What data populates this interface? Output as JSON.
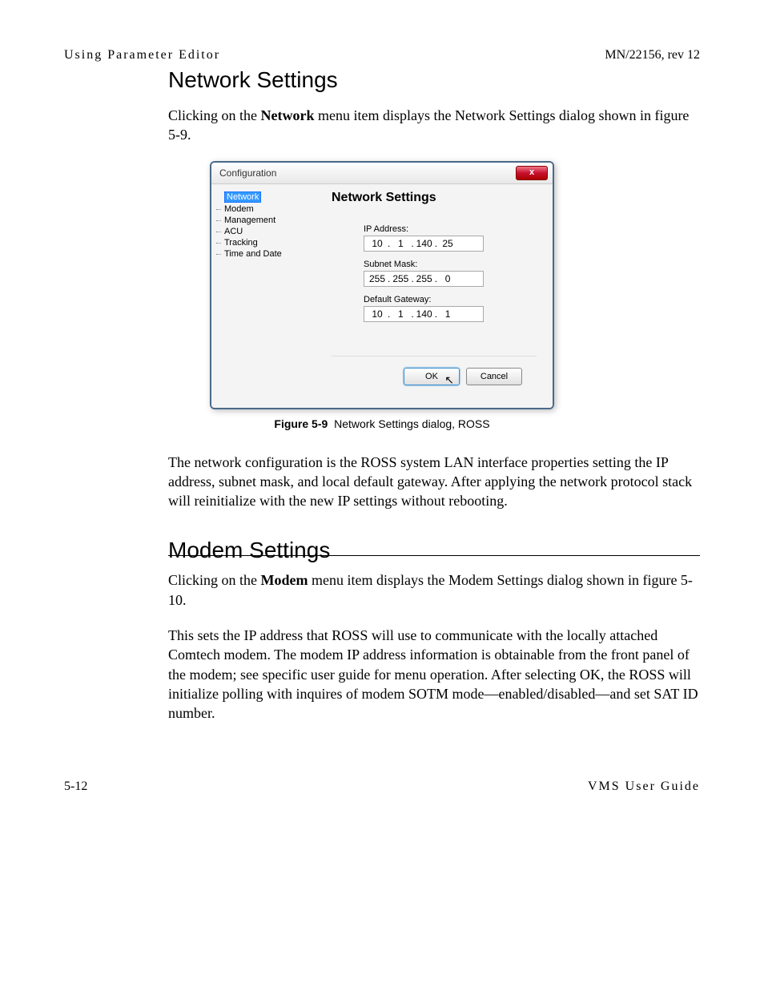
{
  "header": {
    "left": "Using Parameter Editor",
    "right": "MN/22156, rev 12"
  },
  "section1": {
    "title": "Network Settings",
    "para1_parts": [
      "Clicking on the ",
      "Network",
      " menu item displays the Network Settings dialog shown in figure 5-9."
    ]
  },
  "dialog": {
    "title": "Configuration",
    "close": "x",
    "tree": {
      "items": [
        "Network",
        "Modem",
        "Management",
        "ACU",
        "Tracking",
        "Time and Date"
      ]
    },
    "panel": {
      "title": "Network Settings",
      "ip_label": "IP Address:",
      "ip": [
        "10",
        "1",
        "140",
        "25"
      ],
      "mask_label": "Subnet Mask:",
      "mask": [
        "255",
        "255",
        "255",
        "0"
      ],
      "gw_label": "Default Gateway:",
      "gw": [
        "10",
        "1",
        "140",
        "1"
      ]
    },
    "buttons": {
      "ok": "OK",
      "cancel": "Cancel"
    }
  },
  "figure": {
    "label": "Figure 5-9",
    "caption": "Network Settings dialog, ROSS"
  },
  "para2": "The network configuration is the ROSS system LAN interface properties setting the IP address, subnet mask, and local default gateway. After applying the network protocol stack will reinitialize with the new IP settings without rebooting.",
  "section2": {
    "title": "Modem Settings",
    "para1_parts": [
      "Clicking on the ",
      "Modem",
      " menu item displays the Modem Settings dialog shown in figure 5-10."
    ],
    "para2": "This sets the IP address that ROSS will use to communicate with the locally attached Comtech modem. The modem IP address information is obtainable from the front panel of the modem; see specific user guide for menu operation. After selecting OK, the ROSS will initialize polling with inquires of modem SOTM mode—enabled/disabled—and set SAT ID number."
  },
  "footer": {
    "left": "5-12",
    "right": "VMS User Guide"
  }
}
